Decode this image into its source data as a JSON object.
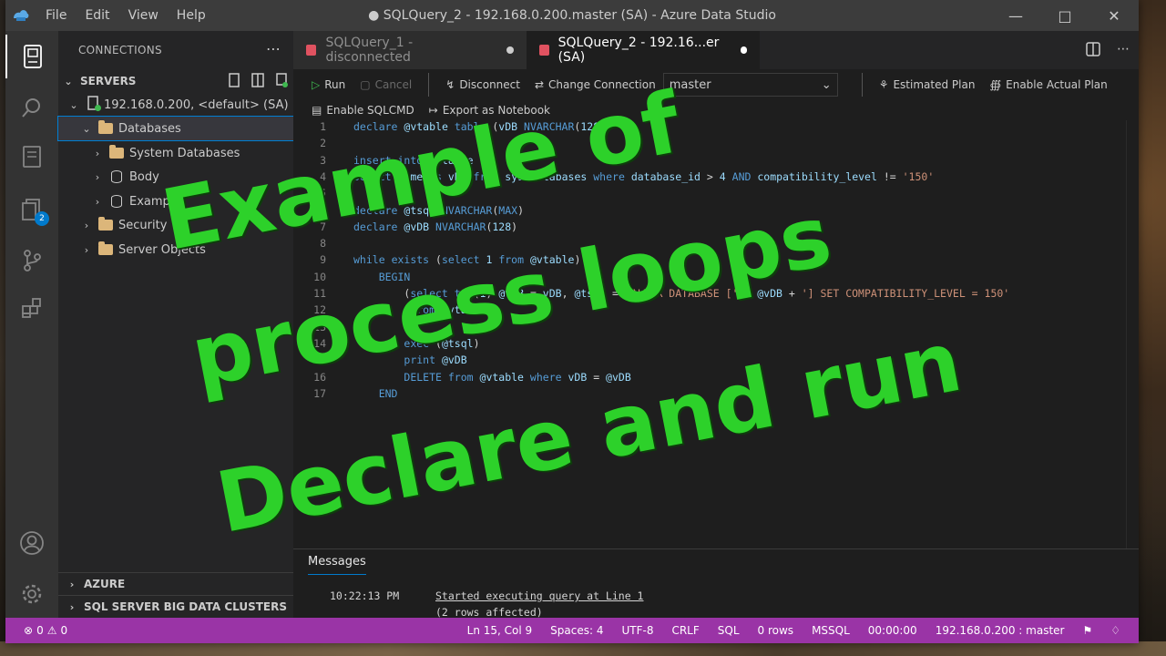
{
  "app": {
    "window_title": "● SQLQuery_2 - 192.168.0.200.master (SA) - Azure Data Studio",
    "menu": [
      "File",
      "Edit",
      "View",
      "Help"
    ]
  },
  "activity": {
    "badge_count": "2"
  },
  "sidebar": {
    "header": "CONNECTIONS",
    "servers_label": "SERVERS",
    "server_node": "192.168.0.200, <default> (SA)",
    "tree": [
      {
        "label": "Databases"
      },
      {
        "label": "System Databases"
      },
      {
        "label": "Body"
      },
      {
        "label": "Example"
      },
      {
        "label": "Security"
      },
      {
        "label": "Server Objects"
      }
    ],
    "sections": [
      "AZURE",
      "SQL SERVER BIG DATA CLUSTERS"
    ]
  },
  "tabs": [
    {
      "label": "SQLQuery_1 - disconnected"
    },
    {
      "label": "SQLQuery_2 - 192.16...er (SA)"
    }
  ],
  "toolbar": {
    "run": "Run",
    "cancel": "Cancel",
    "disconnect": "Disconnect",
    "change_connection": "Change Connection",
    "database": "master",
    "estimated_plan": "Estimated Plan",
    "enable_actual_plan": "Enable Actual Plan",
    "enable_sqlcmd": "Enable SQLCMD",
    "export_notebook": "Export as Notebook"
  },
  "code_lines": [
    "declare @vtable table (vDB NVARCHAR(128))",
    "",
    "insert into @vtable",
    "select name as vDB from sys.databases where database_id > 4 AND compatibility_level != '150'",
    "",
    "declare @tsql NVARCHAR(MAX)",
    "declare @vDB NVARCHAR(128)",
    "",
    "while exists (select 1 from @vtable)",
    "    BEGIN",
    "        (select top(1) @vDB = vDB, @tsql = 'ALTER DATABASE [' + @vDB + '] SET COMPATIBILITY_LEVEL = 150'",
    "         from @vtable)",
    "",
    "        exec (@tsql)",
    "        print @vDB",
    "        DELETE from @vtable where vDB = @vDB",
    "    END"
  ],
  "results": {
    "tab": "Messages",
    "rows": [
      {
        "time": "10:22:13 PM",
        "text": "Started executing query at Line 1"
      },
      {
        "time": "",
        "text": "(2 rows affected)"
      }
    ]
  },
  "status": {
    "errors": "0",
    "warnings": "0",
    "position": "Ln 15, Col 9",
    "spaces": "Spaces: 4",
    "encoding": "UTF-8",
    "eol": "CRLF",
    "language": "SQL",
    "rows": "0 rows",
    "provider": "MSSQL",
    "elapsed": "00:00:00",
    "connection": "192.168.0.200 : master"
  },
  "overlay": {
    "line1": "Example of",
    "line2": "process loops",
    "line3": "Declare and run",
    "color": "#2dd12a"
  }
}
